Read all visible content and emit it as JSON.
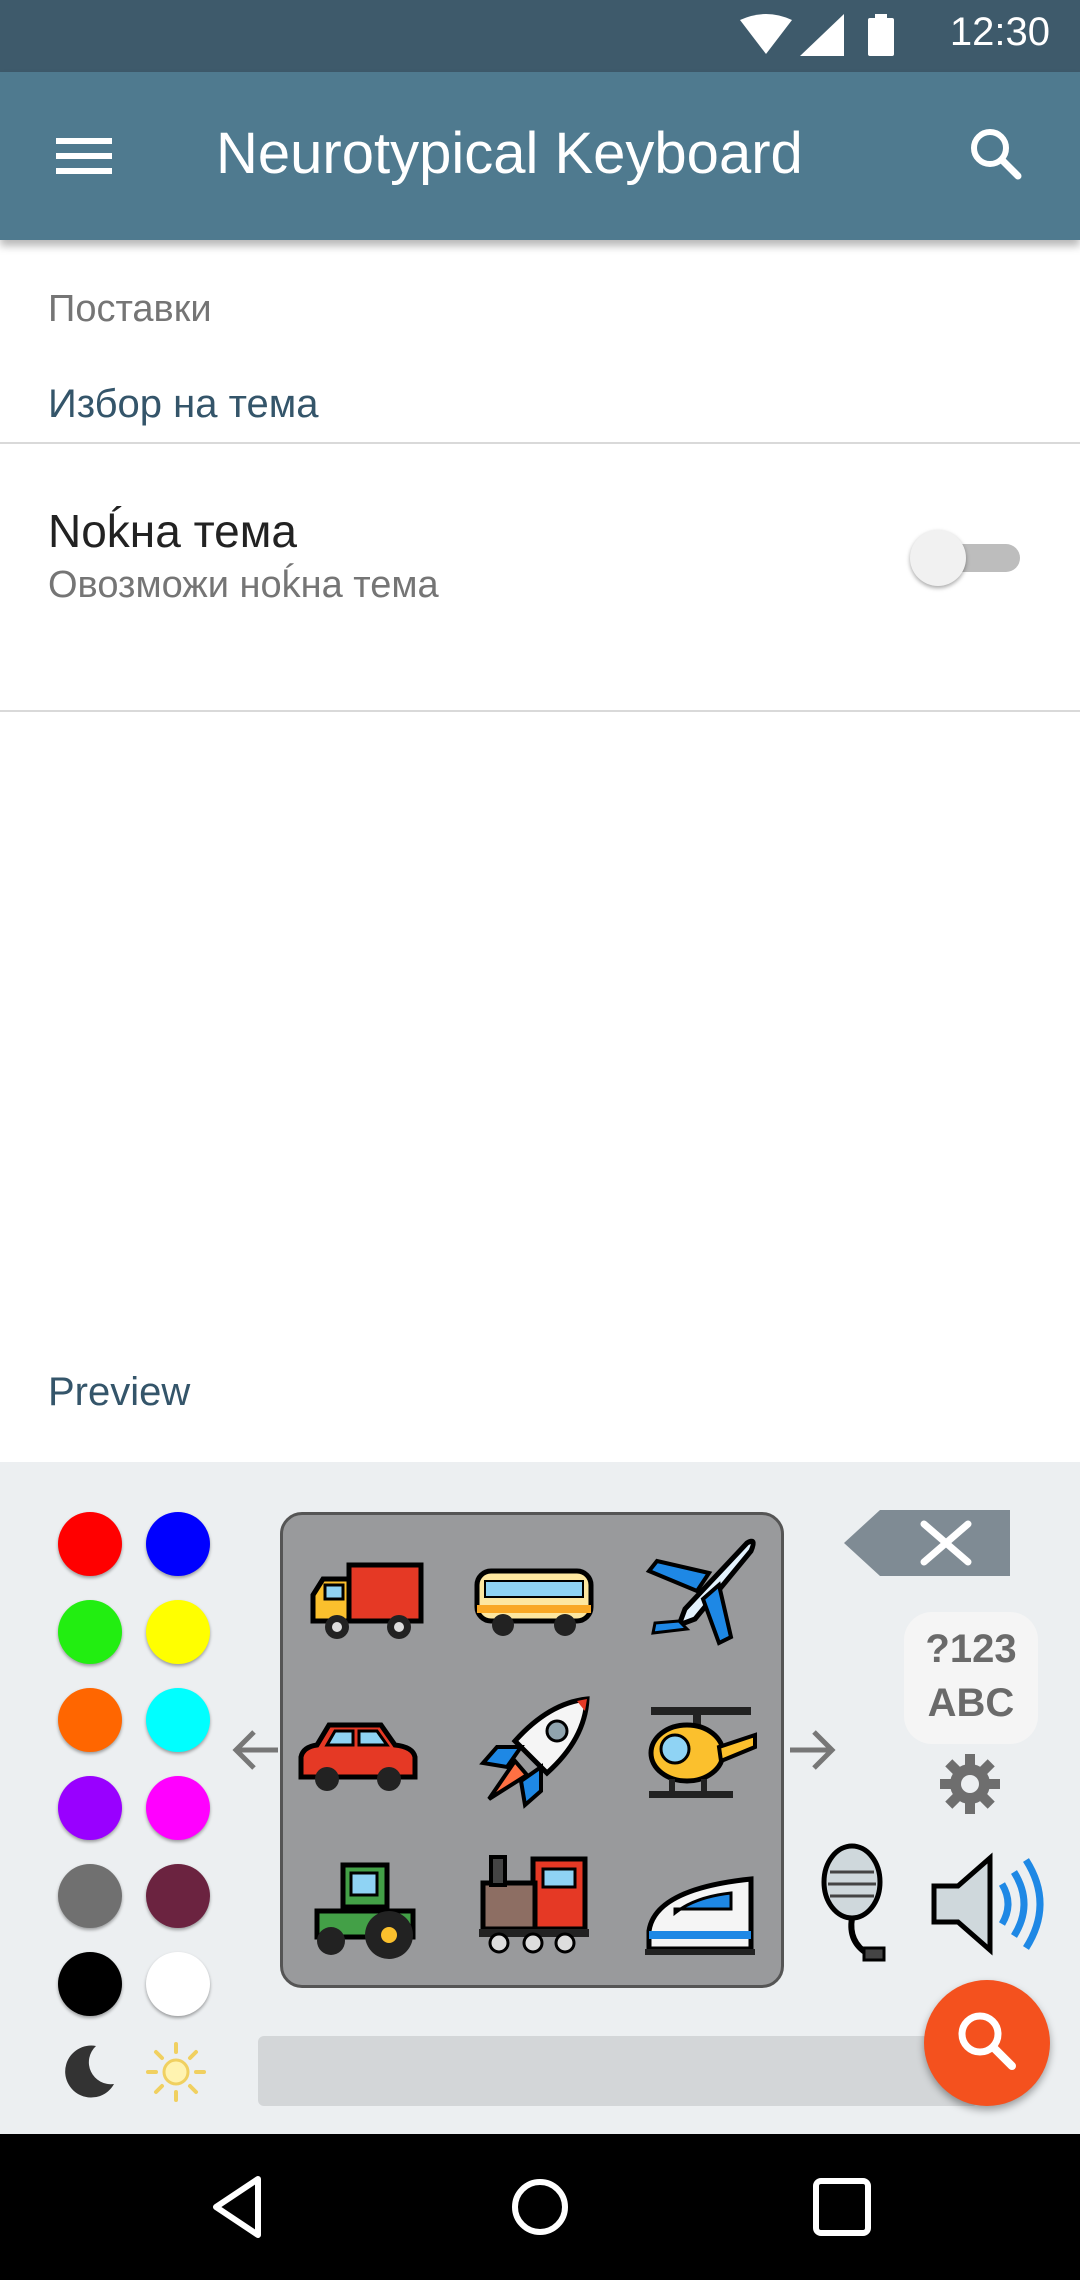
{
  "status_bar": {
    "time": "12:30",
    "icons": [
      "wifi-icon",
      "signal-icon",
      "battery-icon"
    ]
  },
  "app_bar": {
    "title": "Neurotypical Keyboard",
    "menu_icon": "menu-icon",
    "search_icon": "search-icon"
  },
  "settings": {
    "section_label": "Поставки",
    "category_title": "Избор на тема",
    "night_theme": {
      "title": "Noḱна тема",
      "summary": "Овозможи ноḱна тема",
      "enabled": false
    },
    "preview_label": "Preview"
  },
  "keyboard": {
    "colors": [
      "#ff0000",
      "#0000ff",
      "#22ee11",
      "#ffff00",
      "#ff6600",
      "#00ffff",
      "#9900ff",
      "#ff00ff",
      "#707070",
      "#6b2340",
      "#000000",
      "#ffffff"
    ],
    "theme_icons": [
      "moon-icon",
      "sun-icon"
    ],
    "emoji": [
      "truck-icon",
      "bus-icon",
      "airplane-icon",
      "car-icon",
      "rocket-icon",
      "helicopter-icon",
      "tractor-icon",
      "locomotive-icon",
      "bullet-train-icon"
    ],
    "mode_key": {
      "line1": "?123",
      "line2": "ABC"
    },
    "accent": "#f4511e"
  },
  "colors": {
    "status_bar": "#3e5a6b",
    "app_bar": "#4f7a8f",
    "category": "#34556a"
  }
}
